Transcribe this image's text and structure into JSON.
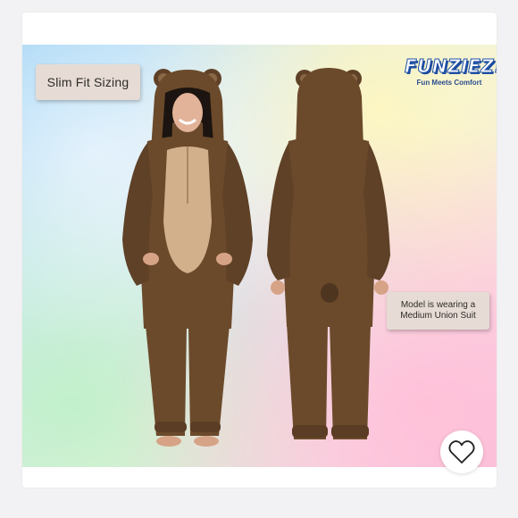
{
  "badges": {
    "fit": "Slim Fit Sizing",
    "model_line1": "Model is wearing a",
    "model_line2": "Medium Union Suit"
  },
  "brand": {
    "logo": "FUNZIEZ!",
    "tagline": "Fun Meets Comfort"
  },
  "colors": {
    "fur": "#6b4a2b",
    "fur_dark": "#4e3520",
    "belly": "#d2b08b",
    "badge": "#e6dcd5",
    "brand_blue": "#1f4fa3"
  },
  "icons": {
    "favorite": "heart-outline-icon"
  }
}
